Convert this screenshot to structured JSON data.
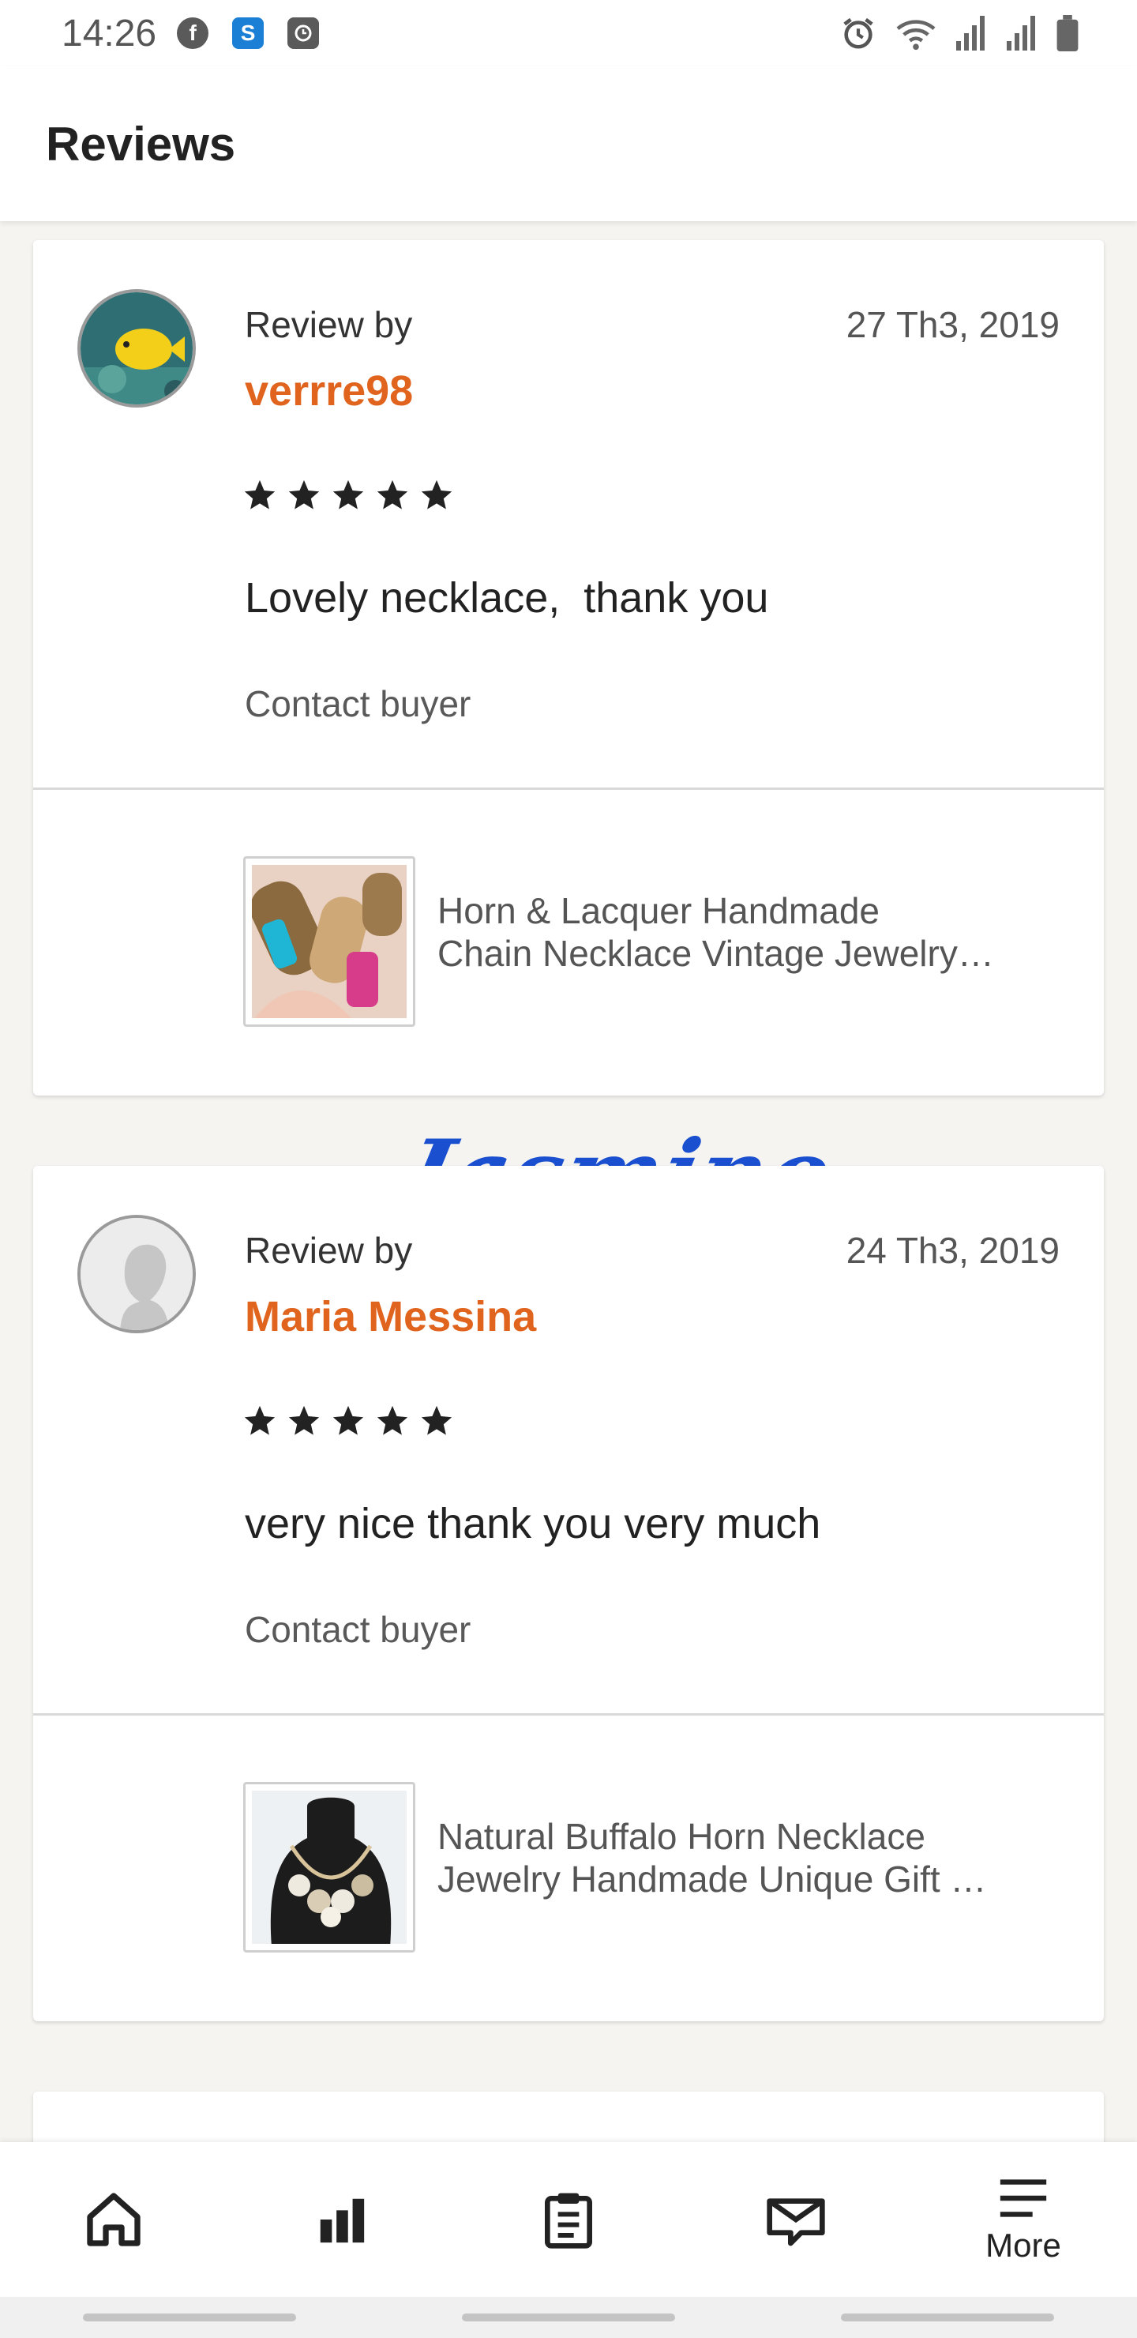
{
  "status_bar": {
    "time": "14:26",
    "left_icons": [
      "facebook-icon",
      "s-app-icon",
      "clock-app-icon"
    ],
    "right_icons": [
      "alarm-icon",
      "wifi-icon",
      "signal-icon",
      "signal-icon",
      "battery-icon"
    ]
  },
  "header": {
    "title": "Reviews"
  },
  "reviews": [
    {
      "review_by_label": "Review by",
      "reviewer": "verrre98",
      "date": "27 Th3, 2019",
      "stars": "★★★★★",
      "rating": 5,
      "text": "Lovely necklace,  thank you",
      "contact_label": "Contact buyer",
      "listing_line1": "Horn & Lacquer Handmade",
      "listing_line2": "Chain Necklace Vintage Jewelry…"
    },
    {
      "review_by_label": "Review by",
      "reviewer": "Maria Messina",
      "date": "24 Th3, 2019",
      "stars": "★★★★★",
      "rating": 5,
      "text": "very nice thank you very much",
      "contact_label": "Contact buyer",
      "listing_line1": "Natural Buffalo Horn Necklace",
      "listing_line2": "Jewelry Handmade Unique Gift …"
    }
  ],
  "watermark": "Jasmino",
  "bottom_nav": {
    "items": [
      "home-icon",
      "stats-icon",
      "orders-icon",
      "messages-icon",
      "menu-icon"
    ],
    "more_label": "More"
  },
  "colors": {
    "accent": "#e0641d",
    "background": "#f5f4f1",
    "watermark": "#1a4fd0"
  }
}
